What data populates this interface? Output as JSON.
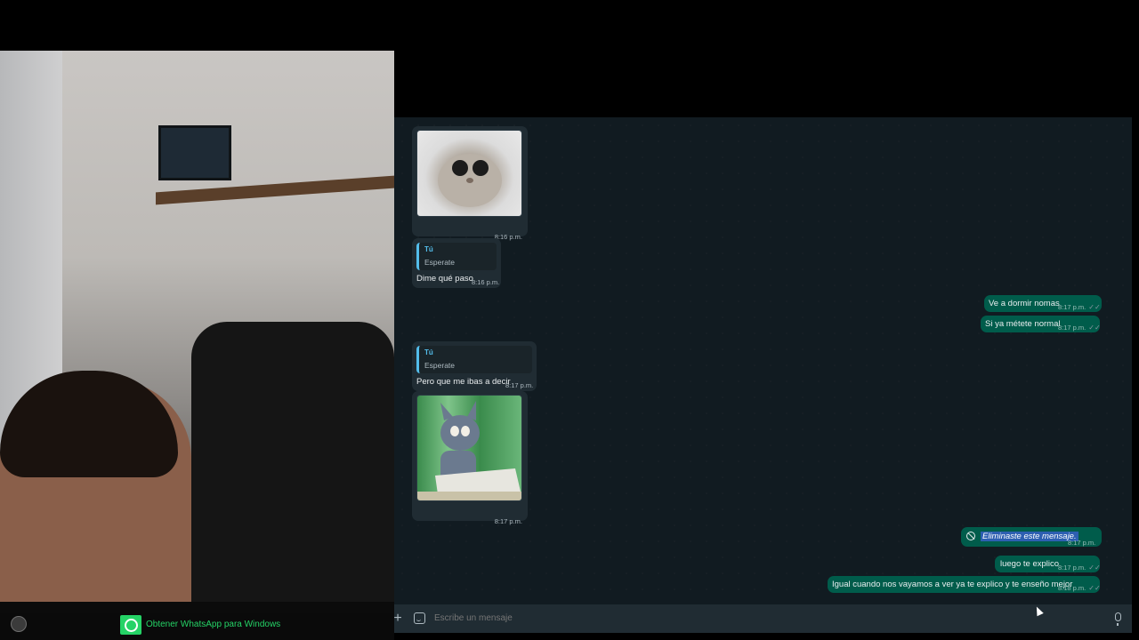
{
  "incoming": [
    {
      "time": "8:16 p.m."
    },
    {
      "quote_author": "Tú",
      "quote_text": "Esperate",
      "text": "Dime qué paso",
      "time": "8:16 p.m."
    },
    {
      "quote_author": "Tú",
      "quote_text": "Esperate",
      "text": "Pero que me ibas a decir",
      "time": "8:17 p.m."
    },
    {
      "time": "8:17 p.m."
    }
  ],
  "outgoing": [
    {
      "text": "Ve a dormir nomas",
      "time": "8:17 p.m."
    },
    {
      "text": "Si ya métete normal",
      "time": "8:17 p.m."
    },
    {
      "text": "Eliminaste este mensaje.",
      "time": "8:17 p.m."
    },
    {
      "text": "luego te explico",
      "time": "8:17 p.m."
    },
    {
      "text": "Igual cuando nos vayamos a ver ya te explico y te enseño mejor",
      "time": "8:18 p.m."
    }
  ],
  "compose": {
    "placeholder": "Escribe un mensaje"
  },
  "banner": {
    "text": "Obtener WhatsApp para Windows"
  },
  "colors": {
    "chat_bg": "#111b21",
    "incoming_bubble": "#202c33",
    "outgoing_bubble": "#005c4b",
    "accent": "#25d366",
    "quote_bar": "#53bdeb"
  }
}
